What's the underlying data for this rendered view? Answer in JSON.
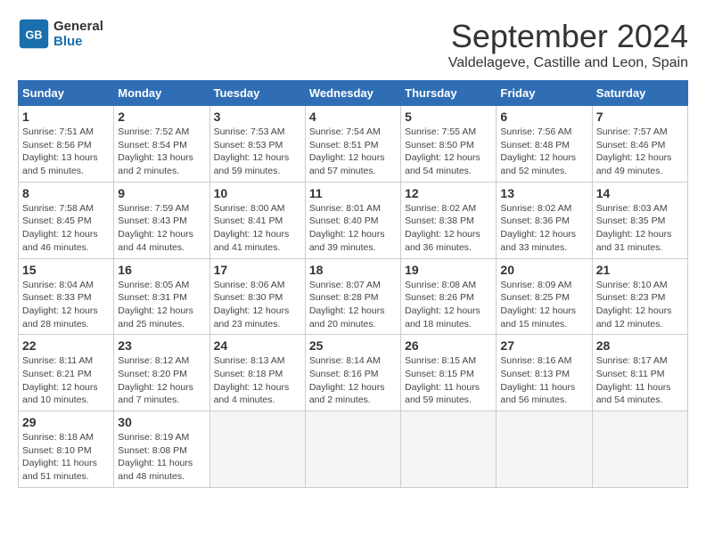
{
  "header": {
    "logo_line1": "General",
    "logo_line2": "Blue",
    "month_year": "September 2024",
    "location": "Valdelageve, Castille and Leon, Spain"
  },
  "calendar": {
    "days_of_week": [
      "Sunday",
      "Monday",
      "Tuesday",
      "Wednesday",
      "Thursday",
      "Friday",
      "Saturday"
    ],
    "weeks": [
      [
        null,
        {
          "day": "2",
          "sunrise": "Sunrise: 7:52 AM",
          "sunset": "Sunset: 8:54 PM",
          "daylight": "Daylight: 13 hours and 2 minutes."
        },
        {
          "day": "3",
          "sunrise": "Sunrise: 7:53 AM",
          "sunset": "Sunset: 8:53 PM",
          "daylight": "Daylight: 12 hours and 59 minutes."
        },
        {
          "day": "4",
          "sunrise": "Sunrise: 7:54 AM",
          "sunset": "Sunset: 8:51 PM",
          "daylight": "Daylight: 12 hours and 57 minutes."
        },
        {
          "day": "5",
          "sunrise": "Sunrise: 7:55 AM",
          "sunset": "Sunset: 8:50 PM",
          "daylight": "Daylight: 12 hours and 54 minutes."
        },
        {
          "day": "6",
          "sunrise": "Sunrise: 7:56 AM",
          "sunset": "Sunset: 8:48 PM",
          "daylight": "Daylight: 12 hours and 52 minutes."
        },
        {
          "day": "7",
          "sunrise": "Sunrise: 7:57 AM",
          "sunset": "Sunset: 8:46 PM",
          "daylight": "Daylight: 12 hours and 49 minutes."
        }
      ],
      [
        {
          "day": "1",
          "sunrise": "Sunrise: 7:51 AM",
          "sunset": "Sunset: 8:56 PM",
          "daylight": "Daylight: 13 hours and 5 minutes."
        },
        {
          "day": "9",
          "sunrise": "Sunrise: 7:59 AM",
          "sunset": "Sunset: 8:43 PM",
          "daylight": "Daylight: 12 hours and 44 minutes."
        },
        {
          "day": "10",
          "sunrise": "Sunrise: 8:00 AM",
          "sunset": "Sunset: 8:41 PM",
          "daylight": "Daylight: 12 hours and 41 minutes."
        },
        {
          "day": "11",
          "sunrise": "Sunrise: 8:01 AM",
          "sunset": "Sunset: 8:40 PM",
          "daylight": "Daylight: 12 hours and 39 minutes."
        },
        {
          "day": "12",
          "sunrise": "Sunrise: 8:02 AM",
          "sunset": "Sunset: 8:38 PM",
          "daylight": "Daylight: 12 hours and 36 minutes."
        },
        {
          "day": "13",
          "sunrise": "Sunrise: 8:02 AM",
          "sunset": "Sunset: 8:36 PM",
          "daylight": "Daylight: 12 hours and 33 minutes."
        },
        {
          "day": "14",
          "sunrise": "Sunrise: 8:03 AM",
          "sunset": "Sunset: 8:35 PM",
          "daylight": "Daylight: 12 hours and 31 minutes."
        }
      ],
      [
        {
          "day": "8",
          "sunrise": "Sunrise: 7:58 AM",
          "sunset": "Sunset: 8:45 PM",
          "daylight": "Daylight: 12 hours and 46 minutes."
        },
        {
          "day": "16",
          "sunrise": "Sunrise: 8:05 AM",
          "sunset": "Sunset: 8:31 PM",
          "daylight": "Daylight: 12 hours and 25 minutes."
        },
        {
          "day": "17",
          "sunrise": "Sunrise: 8:06 AM",
          "sunset": "Sunset: 8:30 PM",
          "daylight": "Daylight: 12 hours and 23 minutes."
        },
        {
          "day": "18",
          "sunrise": "Sunrise: 8:07 AM",
          "sunset": "Sunset: 8:28 PM",
          "daylight": "Daylight: 12 hours and 20 minutes."
        },
        {
          "day": "19",
          "sunrise": "Sunrise: 8:08 AM",
          "sunset": "Sunset: 8:26 PM",
          "daylight": "Daylight: 12 hours and 18 minutes."
        },
        {
          "day": "20",
          "sunrise": "Sunrise: 8:09 AM",
          "sunset": "Sunset: 8:25 PM",
          "daylight": "Daylight: 12 hours and 15 minutes."
        },
        {
          "day": "21",
          "sunrise": "Sunrise: 8:10 AM",
          "sunset": "Sunset: 8:23 PM",
          "daylight": "Daylight: 12 hours and 12 minutes."
        }
      ],
      [
        {
          "day": "15",
          "sunrise": "Sunrise: 8:04 AM",
          "sunset": "Sunset: 8:33 PM",
          "daylight": "Daylight: 12 hours and 28 minutes."
        },
        {
          "day": "23",
          "sunrise": "Sunrise: 8:12 AM",
          "sunset": "Sunset: 8:20 PM",
          "daylight": "Daylight: 12 hours and 7 minutes."
        },
        {
          "day": "24",
          "sunrise": "Sunrise: 8:13 AM",
          "sunset": "Sunset: 8:18 PM",
          "daylight": "Daylight: 12 hours and 4 minutes."
        },
        {
          "day": "25",
          "sunrise": "Sunrise: 8:14 AM",
          "sunset": "Sunset: 8:16 PM",
          "daylight": "Daylight: 12 hours and 2 minutes."
        },
        {
          "day": "26",
          "sunrise": "Sunrise: 8:15 AM",
          "sunset": "Sunset: 8:15 PM",
          "daylight": "Daylight: 11 hours and 59 minutes."
        },
        {
          "day": "27",
          "sunrise": "Sunrise: 8:16 AM",
          "sunset": "Sunset: 8:13 PM",
          "daylight": "Daylight: 11 hours and 56 minutes."
        },
        {
          "day": "28",
          "sunrise": "Sunrise: 8:17 AM",
          "sunset": "Sunset: 8:11 PM",
          "daylight": "Daylight: 11 hours and 54 minutes."
        }
      ],
      [
        {
          "day": "22",
          "sunrise": "Sunrise: 8:11 AM",
          "sunset": "Sunset: 8:21 PM",
          "daylight": "Daylight: 12 hours and 10 minutes."
        },
        {
          "day": "30",
          "sunrise": "Sunrise: 8:19 AM",
          "sunset": "Sunset: 8:08 PM",
          "daylight": "Daylight: 11 hours and 48 minutes."
        },
        null,
        null,
        null,
        null,
        null
      ],
      [
        {
          "day": "29",
          "sunrise": "Sunrise: 8:18 AM",
          "sunset": "Sunset: 8:10 PM",
          "daylight": "Daylight: 11 hours and 51 minutes."
        },
        null,
        null,
        null,
        null,
        null,
        null
      ]
    ]
  }
}
